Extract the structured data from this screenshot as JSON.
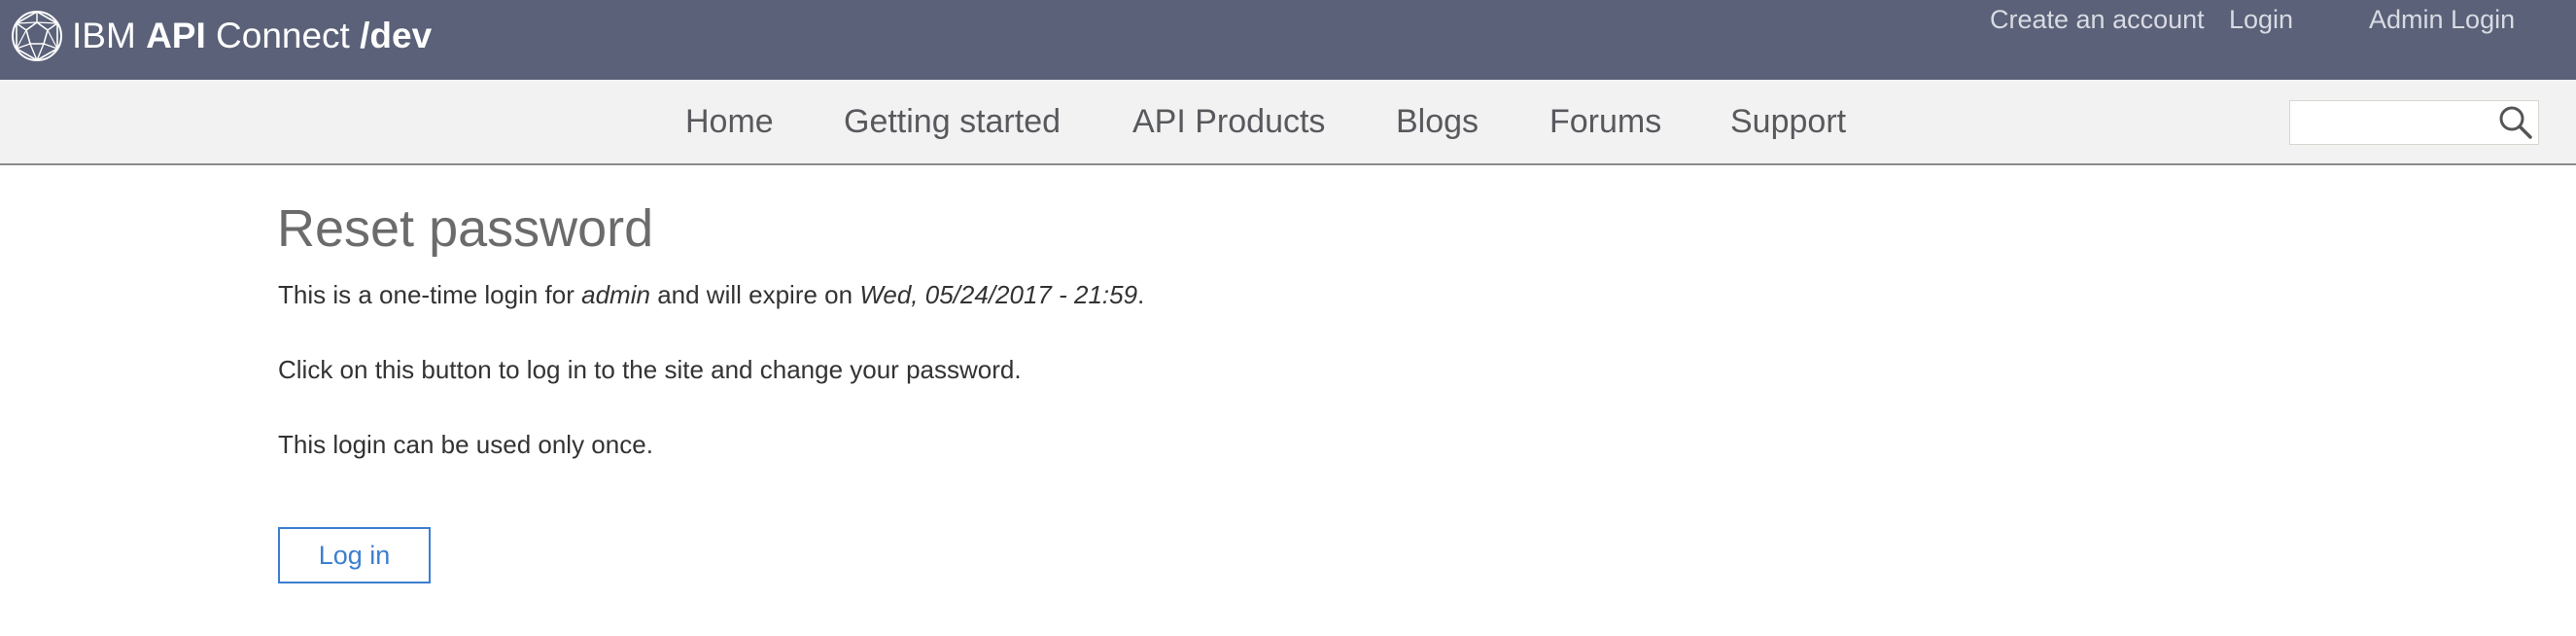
{
  "header": {
    "brand_prefix": "IBM ",
    "brand_bold": "API",
    "brand_middle": " Connect ",
    "brand_suffix": "/dev",
    "links": [
      "Create an account",
      "Login",
      "Admin Login"
    ],
    "colors": {
      "bar": "#5a6178",
      "link": "#d9dbe3"
    }
  },
  "nav": {
    "items": [
      "Home",
      "Getting started",
      "API Products",
      "Blogs",
      "Forums",
      "Support"
    ],
    "search_placeholder": ""
  },
  "main": {
    "title": "Reset password",
    "line1_prefix": "This is a one-time login for ",
    "line1_user": "admin",
    "line1_middle": " and will expire on ",
    "line1_date": "Wed, 05/24/2017 - 21:59",
    "line1_suffix": ".",
    "line2": "Click on this button to log in to the site and change your password.",
    "line3": "This login can be used only once.",
    "button_label": "Log in",
    "accent_color": "#3c7fd0"
  },
  "icons": {
    "logo": "geodesic-sphere-logo-icon",
    "search": "magnifier-search-icon"
  }
}
